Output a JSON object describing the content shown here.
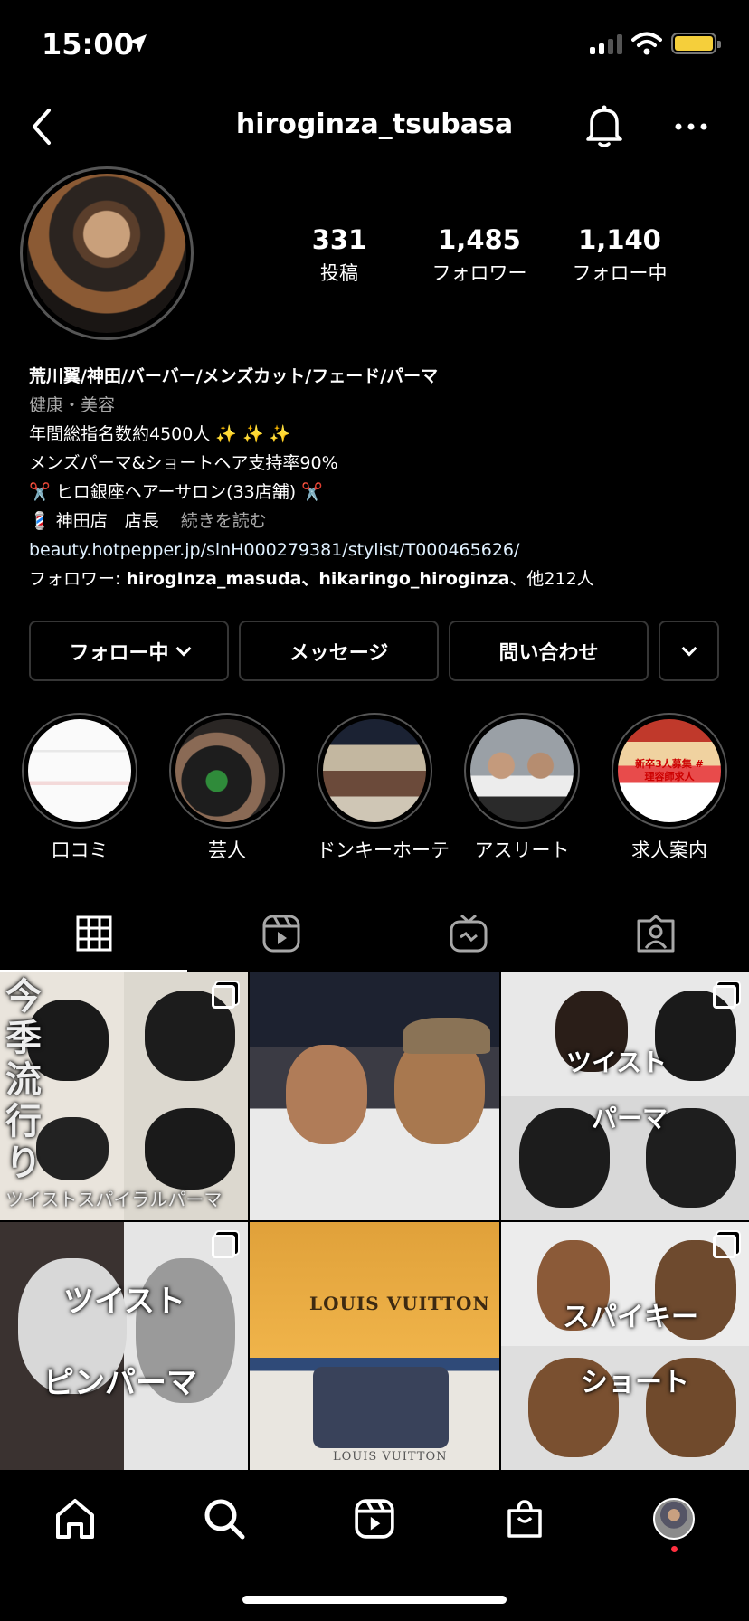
{
  "status": {
    "time": "15:00"
  },
  "header": {
    "username": "hiroginza_tsubasa"
  },
  "stats": [
    {
      "num": "331",
      "label": "投稿"
    },
    {
      "num": "1,485",
      "label": "フォロワー"
    },
    {
      "num": "1,140",
      "label": "フォロー中"
    }
  ],
  "bio": {
    "name": "荒川翼/神田/バーバー/メンズカット/フェード/パーマ",
    "category": "健康・美容",
    "line1": "年間総指名数約4500人 ✨ ✨ ✨",
    "line2": "メンズパーマ&ショートヘア支持率90%",
    "line3": "✂️ ヒロ銀座ヘアーサロン(33店舗) ✂️",
    "line4": "💈 神田店　店長",
    "more": "続きを読む",
    "link": "beauty.hotpepper.jp/slnH000279381/stylist/T000465626/",
    "followed_prefix": "フォロワー: ",
    "followed_names": "hirogInza_masuda、hikaringo_hiroginza",
    "followed_suffix": "、他212人"
  },
  "buttons": {
    "following": "フォロー中",
    "message": "メッセージ",
    "contact": "問い合わせ"
  },
  "highlights": [
    {
      "label": "口コミ"
    },
    {
      "label": "芸人"
    },
    {
      "label": "ドンキーホーテ"
    },
    {
      "label": "アスリート"
    },
    {
      "label": "求人案内"
    }
  ],
  "posts": {
    "p1_side": "今季流行り",
    "p1_bottom": "ツイストスパイラルパーマ",
    "p3_a": "ツイスト",
    "p3_b": "パーマ",
    "p4_a": "ツイスト",
    "p4_b": "ピンパーマ",
    "p5_a": "LOUIS VUITTON",
    "p5_b": "LOUIS VUITTON",
    "p6_a": "スパイキー",
    "p6_b": "ショート"
  },
  "highlight_5_text": "新卒3人募集 #理容師求人",
  "colors": {
    "background": "#000000",
    "accent_battery": "#f5cf3b",
    "notification_dot": "#ff3040"
  }
}
